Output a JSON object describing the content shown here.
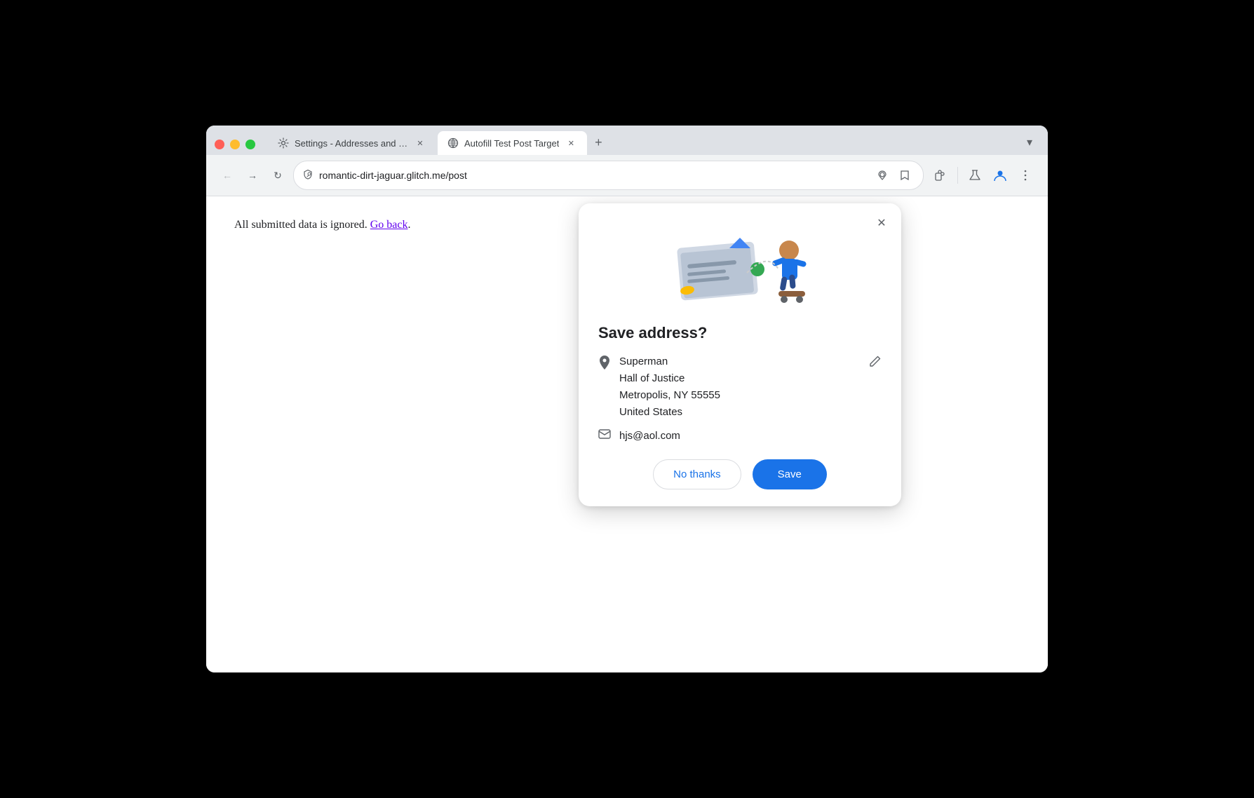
{
  "browser": {
    "tabs": [
      {
        "id": "settings-tab",
        "label": "Settings - Addresses and mo",
        "icon": "gear",
        "active": false,
        "closeable": true
      },
      {
        "id": "autofill-tab",
        "label": "Autofill Test Post Target",
        "icon": "globe",
        "active": true,
        "closeable": true
      }
    ],
    "url": "romantic-dirt-jaguar.glitch.me/post",
    "new_tab_label": "+",
    "chevron_label": "▾"
  },
  "page": {
    "body_text": "All submitted data is ignored. ",
    "link_text": "Go back",
    "link_suffix": "."
  },
  "dialog": {
    "title": "Save address?",
    "close_label": "✕",
    "address": {
      "name": "Superman",
      "line2": "Hall of Justice",
      "line3": "Metropolis, NY 55555",
      "line4": "United States"
    },
    "email": "hjs@aol.com",
    "buttons": {
      "no_thanks": "No thanks",
      "save": "Save"
    }
  },
  "icons": {
    "back": "←",
    "forward": "→",
    "refresh": "↻",
    "location": "📍",
    "star": "☆",
    "extensions": "🧩",
    "lab": "🧪",
    "profile": "👤",
    "menu": "⋮",
    "edit": "✏",
    "pin": "📍",
    "mail": "✉",
    "chevron_down": "⌄"
  }
}
